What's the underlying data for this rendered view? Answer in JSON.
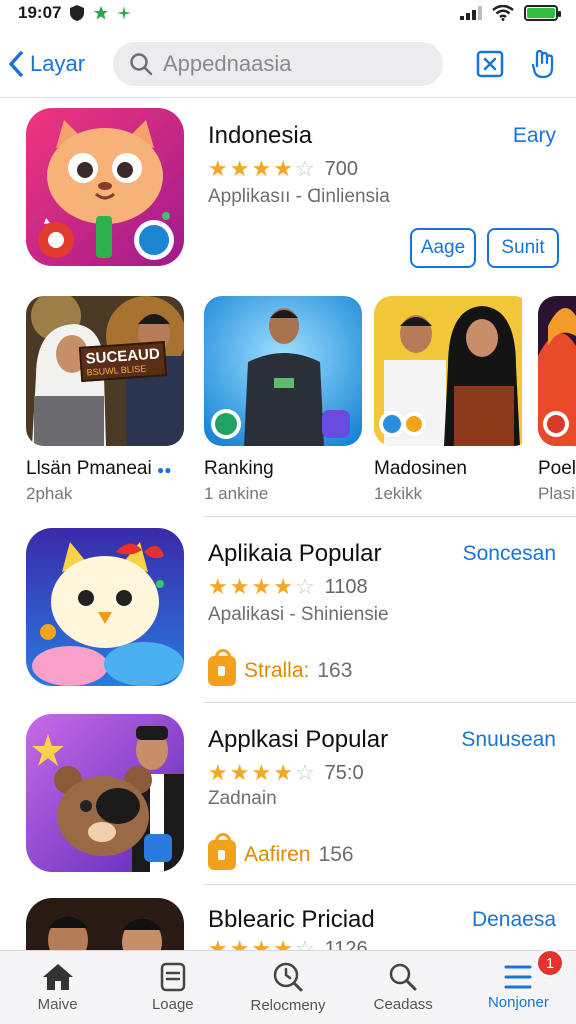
{
  "status_bar": {
    "time": "19:07"
  },
  "nav": {
    "back_label": "Layar",
    "search_placeholder": "Appednaasia"
  },
  "apps": [
    {
      "name": "Indonesia",
      "action": "Eary",
      "rating": 4,
      "rating_count": "700",
      "subtitle": "Applikasıı - Ɑinliensia",
      "buttons": [
        "Aage",
        "Sunit"
      ]
    },
    {
      "name": "Aplikaia Popular",
      "action": "Soncesan",
      "rating": 4,
      "rating_count": "1108",
      "subtitle": "Apalikasi - Shiniensie",
      "meta_label": "Stralla:",
      "meta_value": "163"
    },
    {
      "name": "Applkasi Popular",
      "action": "Snuusean",
      "rating": 4,
      "rating_count": "75:0",
      "subtitle": "Zadnain",
      "meta_label": "Aafiren",
      "meta_value": "156"
    },
    {
      "name": "Bblearic Priciad",
      "action": "Denaesa",
      "rating": 4,
      "rating_count": "1126"
    }
  ],
  "carousel": [
    {
      "title": "Llsän Pmaneai",
      "subtitle": "2phak",
      "banner_line1": "SUCEAUD",
      "banner_line2": "BSUWL BLISE"
    },
    {
      "title": "Ranking",
      "subtitle": "1 ankine"
    },
    {
      "title": "Madosinen",
      "subtitle": "1ekikk"
    },
    {
      "title": "Poel",
      "subtitle": "Plasi"
    }
  ],
  "tabs": [
    {
      "label": "Maive",
      "icon": "home-icon"
    },
    {
      "label": "Loage",
      "icon": "document-icon"
    },
    {
      "label": "Relocmeny",
      "icon": "search-clock-icon"
    },
    {
      "label": "Ceadass",
      "icon": "search-icon"
    },
    {
      "label": "Nonjoner",
      "icon": "menu-icon",
      "badge": "1",
      "active": true
    }
  ],
  "colors": {
    "accent": "#1a73d9",
    "star": "#f5a623",
    "badge": "#e5322d"
  }
}
